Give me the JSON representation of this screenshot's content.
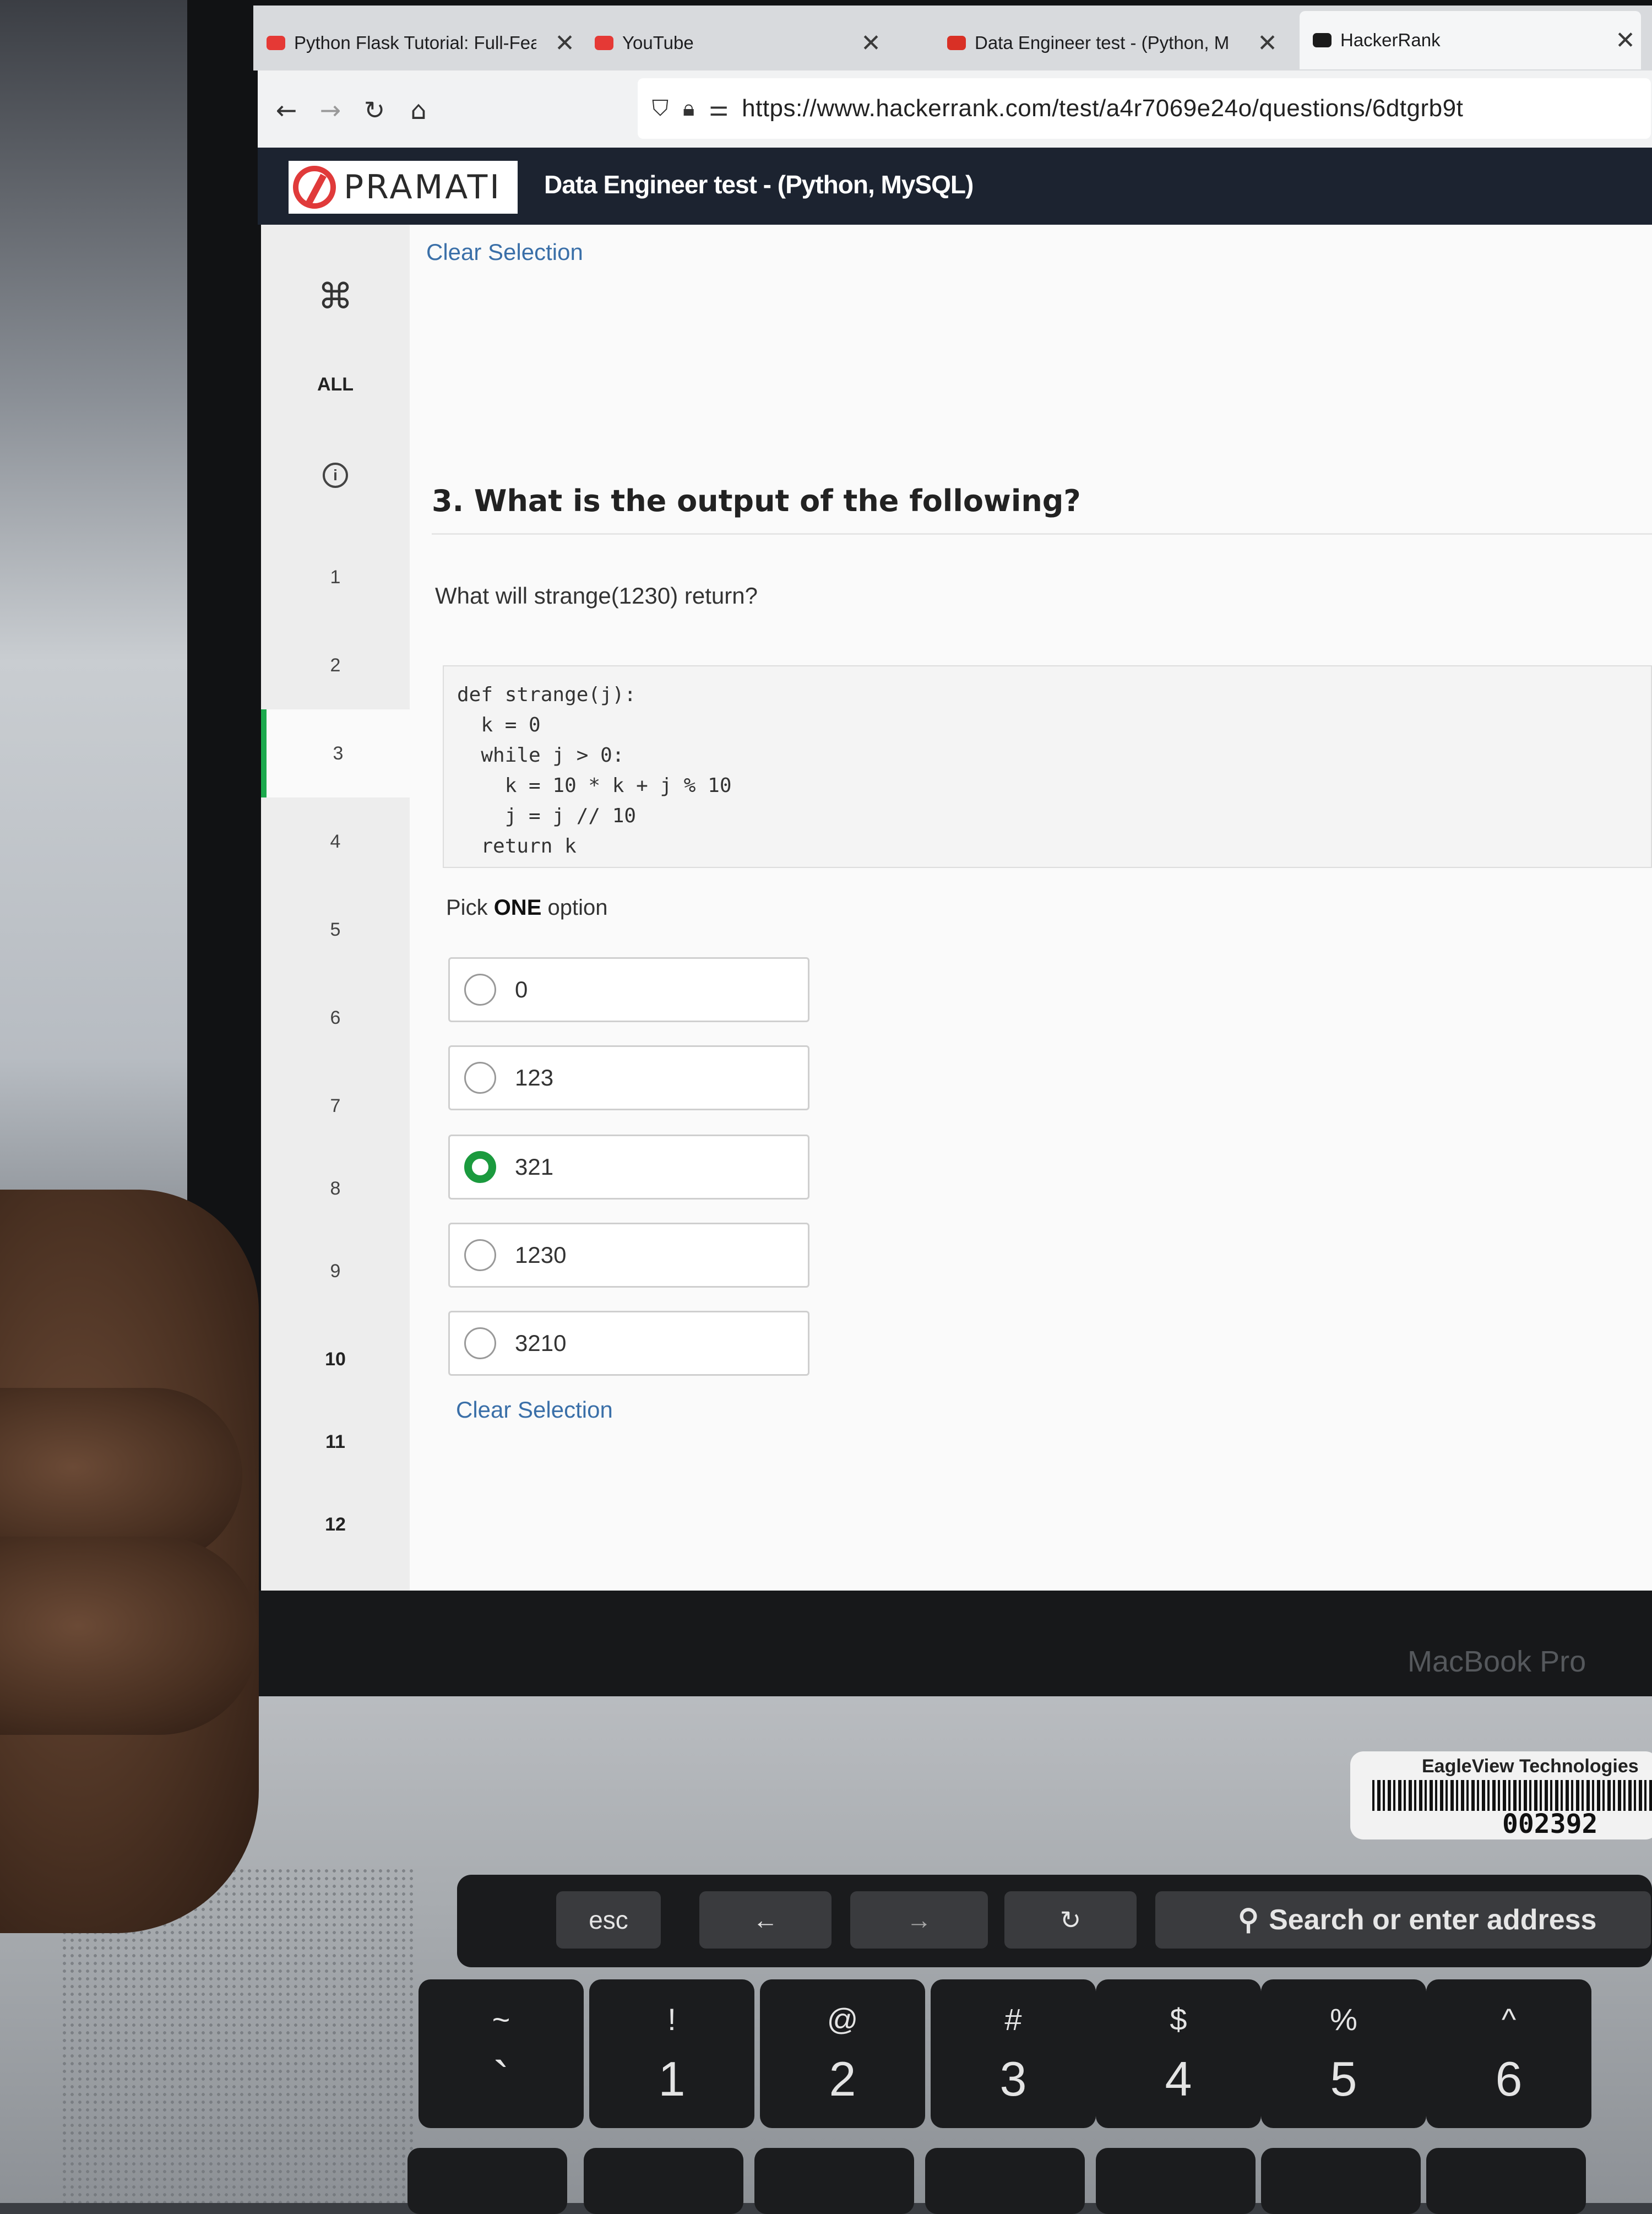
{
  "browser": {
    "tabs": [
      {
        "label": "Python Flask Tutorial: Full-Fea",
        "close": "✕",
        "favicon_color": "#e53935"
      },
      {
        "label": "YouTube",
        "close": "✕",
        "favicon_color": "#e53935"
      },
      {
        "label": "Data Engineer test - (Python, M",
        "close": "✕",
        "favicon_color": "#d93025"
      },
      {
        "label": "HackerRank",
        "close": "✕",
        "favicon_color": "#1b1b1b"
      }
    ],
    "nav": {
      "back": "←",
      "forward": "→",
      "reload": "↻",
      "home": "⌂"
    },
    "url": "https://www.hackerrank.com/test/a4r7069e24o/questions/6dtgrb9t"
  },
  "app": {
    "logo_text": "PRAMATI",
    "test_title": "Data Engineer test - (Python, MySQL)",
    "accent": "#1ba94c"
  },
  "sidebar": {
    "command_icon": "⌘",
    "all_label": "ALL",
    "info_icon": "i",
    "questions": [
      "1",
      "2",
      "3",
      "4",
      "5",
      "6",
      "7",
      "8",
      "9",
      "10",
      "11",
      "12"
    ],
    "active_question": "3"
  },
  "question": {
    "clear_selection_top": "Clear Selection",
    "title": "3. What is the output of the following?",
    "prompt": "What will strange(1230) return?",
    "code": "def strange(j):\n  k = 0\n  while j > 0:\n    k = 10 * k + j % 10\n    j = j // 10\n  return k",
    "pick_prefix": "Pick ",
    "pick_bold": "ONE",
    "pick_suffix": " option",
    "options": [
      "0",
      "123",
      "321",
      "1230",
      "3210"
    ],
    "selected_index": 2,
    "clear_selection_bottom": "Clear Selection"
  },
  "laptop": {
    "brand": "MacBook Pro",
    "sticker_company": "EagleView Technologies",
    "sticker_number": "002392",
    "touchbar": {
      "esc": "esc",
      "back": "←",
      "forward": "→",
      "reload": "↻",
      "search": "Search or enter address"
    },
    "keys": [
      {
        "top": "~",
        "bottom": "`"
      },
      {
        "top": "!",
        "bottom": "1"
      },
      {
        "top": "@",
        "bottom": "2"
      },
      {
        "top": "#",
        "bottom": "3"
      },
      {
        "top": "$",
        "bottom": "4"
      },
      {
        "top": "%",
        "bottom": "5"
      },
      {
        "top": "^",
        "bottom": "6"
      }
    ]
  }
}
